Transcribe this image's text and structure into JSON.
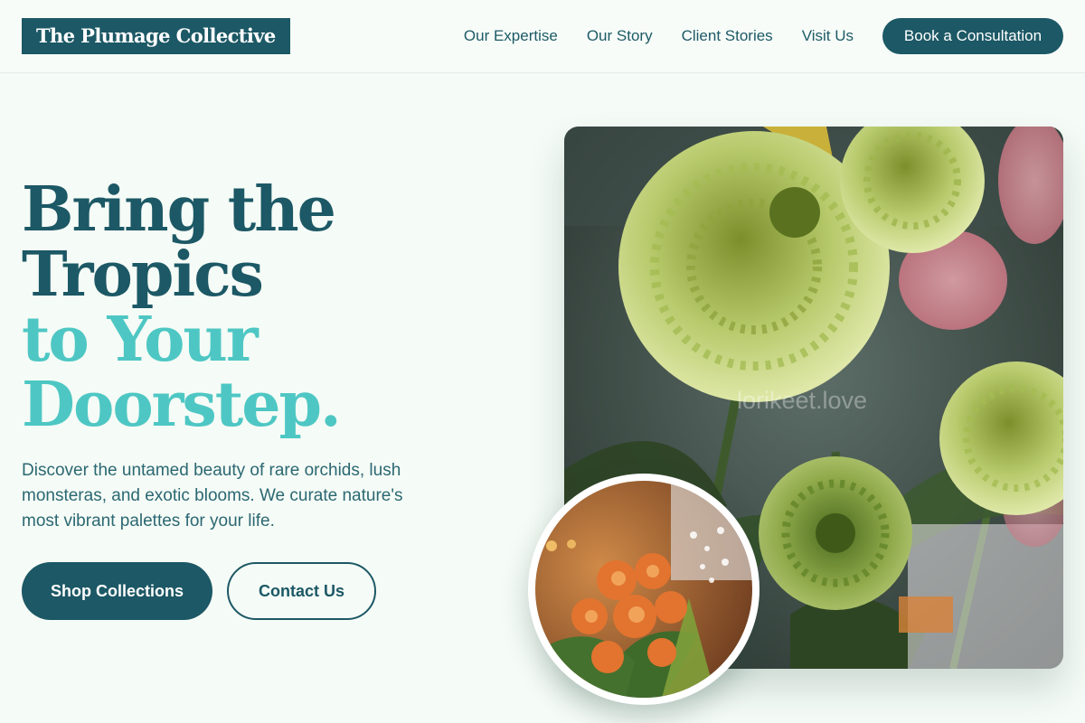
{
  "header": {
    "logo": "The Plumage Collective",
    "nav": [
      {
        "label": "Our Expertise"
      },
      {
        "label": "Our Story"
      },
      {
        "label": "Client Stories"
      },
      {
        "label": "Visit Us"
      }
    ],
    "cta_label": "Book a Consultation"
  },
  "hero": {
    "headline_line1": "Bring the",
    "headline_line2": "Tropics",
    "headline_line3": "to Your",
    "headline_line4": "Doorstep.",
    "description": "Discover the untamed beauty of rare orchids, lush monsteras, and exotic blooms. We curate nature's most vibrant palettes for your life.",
    "primary_button": "Shop Collections",
    "secondary_button": "Contact Us",
    "image_watermark": "lorikeet.love"
  },
  "colors": {
    "brand_dark": "#1c5865",
    "brand_accent": "#4ec7c4",
    "background": "#f5fbf6"
  },
  "icons": {
    "main_image": "green-chrysanthemum-photo",
    "circle_image": "orange-alstroemeria-photo"
  }
}
